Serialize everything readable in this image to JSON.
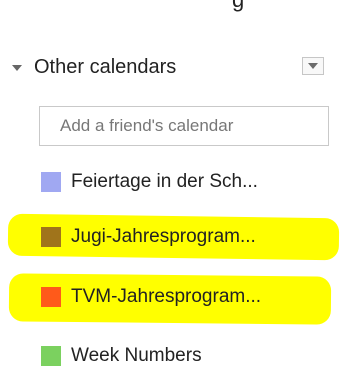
{
  "top_clipped_text": "g",
  "other_calendars": {
    "title": "Other calendars",
    "add_friend_placeholder": "Add a friend's calendar"
  },
  "calendars": [
    {
      "label": "Feiertage in der Sch...",
      "color": "#a0a8f2",
      "highlighted": false
    },
    {
      "label": "Jugi-Jahresprogram...",
      "color": "#a0741b",
      "highlighted": true
    },
    {
      "label": "TVM-Jahresprogram...",
      "color": "#ff5a1a",
      "highlighted": true
    },
    {
      "label": "Week Numbers",
      "color": "#7bd15f",
      "highlighted": false
    }
  ],
  "colors": {
    "highlight": "#ffff00"
  }
}
